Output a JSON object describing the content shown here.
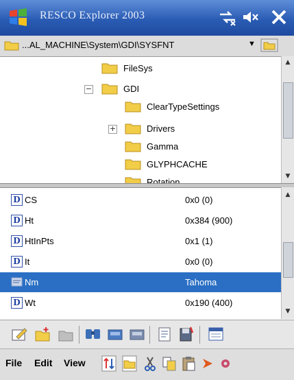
{
  "titlebar": {
    "app_title": "RESCO Explorer 2003",
    "icons": [
      "windows-logo-icon",
      "connectivity-icon",
      "volume-icon",
      "close-icon"
    ]
  },
  "pathbar": {
    "path": "...AL_MACHINE\\System\\GDI\\SYSFNT",
    "dropdown": "▼",
    "icons": [
      "folder-icon",
      "up-folder-icon"
    ]
  },
  "tree": {
    "items": [
      {
        "label": "FileSys"
      },
      {
        "label": "GDI",
        "expander": "−"
      },
      {
        "label": "ClearTypeSettings"
      },
      {
        "label": "Drivers",
        "expander": "+"
      },
      {
        "label": "Gamma"
      },
      {
        "label": "GLYPHCACHE"
      },
      {
        "label": "Rotation"
      }
    ],
    "folder_color": "#f2cd48"
  },
  "values": {
    "rows": [
      {
        "name": "CS",
        "value": "0x0 (0)",
        "icon": "dword-value-icon"
      },
      {
        "name": "Ht",
        "value": "0x384 (900)",
        "icon": "dword-value-icon"
      },
      {
        "name": "HtInPts",
        "value": "0x1 (1)",
        "icon": "dword-value-icon"
      },
      {
        "name": "It",
        "value": "0x0 (0)",
        "icon": "dword-value-icon"
      },
      {
        "name": "Nm",
        "value": "Tahoma",
        "icon": "string-value-icon",
        "selected": true
      },
      {
        "name": "Wt",
        "value": "0x190 (400)",
        "icon": "dword-value-icon"
      }
    ],
    "dword_glyph": "D",
    "selection_color": "#2a6fc4"
  },
  "toolbar": {
    "icons": [
      "edit-icon",
      "new-folder-icon",
      "new-key-icon",
      "find-icon",
      "copy-icon",
      "paste-icon",
      "export-icon",
      "save-icon",
      "properties-icon"
    ]
  },
  "menubar": {
    "file": "File",
    "edit": "Edit",
    "view": "View",
    "icons": [
      "sort-icon",
      "folder-toggle-icon",
      "cut-icon",
      "copy-icon",
      "paste-icon",
      "arrow-icon",
      "tools-icon"
    ]
  }
}
